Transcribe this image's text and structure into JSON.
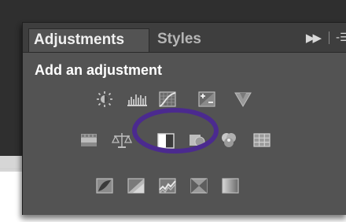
{
  "panel": {
    "tabs": [
      {
        "label": "Adjustments",
        "active": true
      },
      {
        "label": "Styles",
        "active": false
      }
    ],
    "controls": {
      "expand_icon": "fast-forward-icon",
      "menu_icon": "panel-menu-icon"
    },
    "heading": "Add an adjustment",
    "icon_rows": [
      [
        "brightness-contrast-icon",
        "levels-icon",
        "curves-icon",
        "exposure-icon",
        "vibrance-icon"
      ],
      [
        "hue-saturation-icon",
        "color-balance-icon",
        "black-white-icon",
        "photo-filter-icon",
        "channel-mixer-icon",
        "color-lookup-icon"
      ],
      [
        "invert-icon",
        "posterize-icon",
        "threshold-icon",
        "selective-color-icon",
        "gradient-map-icon"
      ]
    ],
    "highlight": {
      "target": "black-white-icon",
      "color": "#4b2a8f"
    }
  },
  "colors": {
    "panel_bg": "#535353",
    "tabbar_bg": "#3e3e3e",
    "active_tab_text": "#f0f0f0",
    "inactive_tab_text": "#b5b5b5",
    "icon_light": "#c8c8c8",
    "highlight_ring": "#4b2a8f"
  }
}
